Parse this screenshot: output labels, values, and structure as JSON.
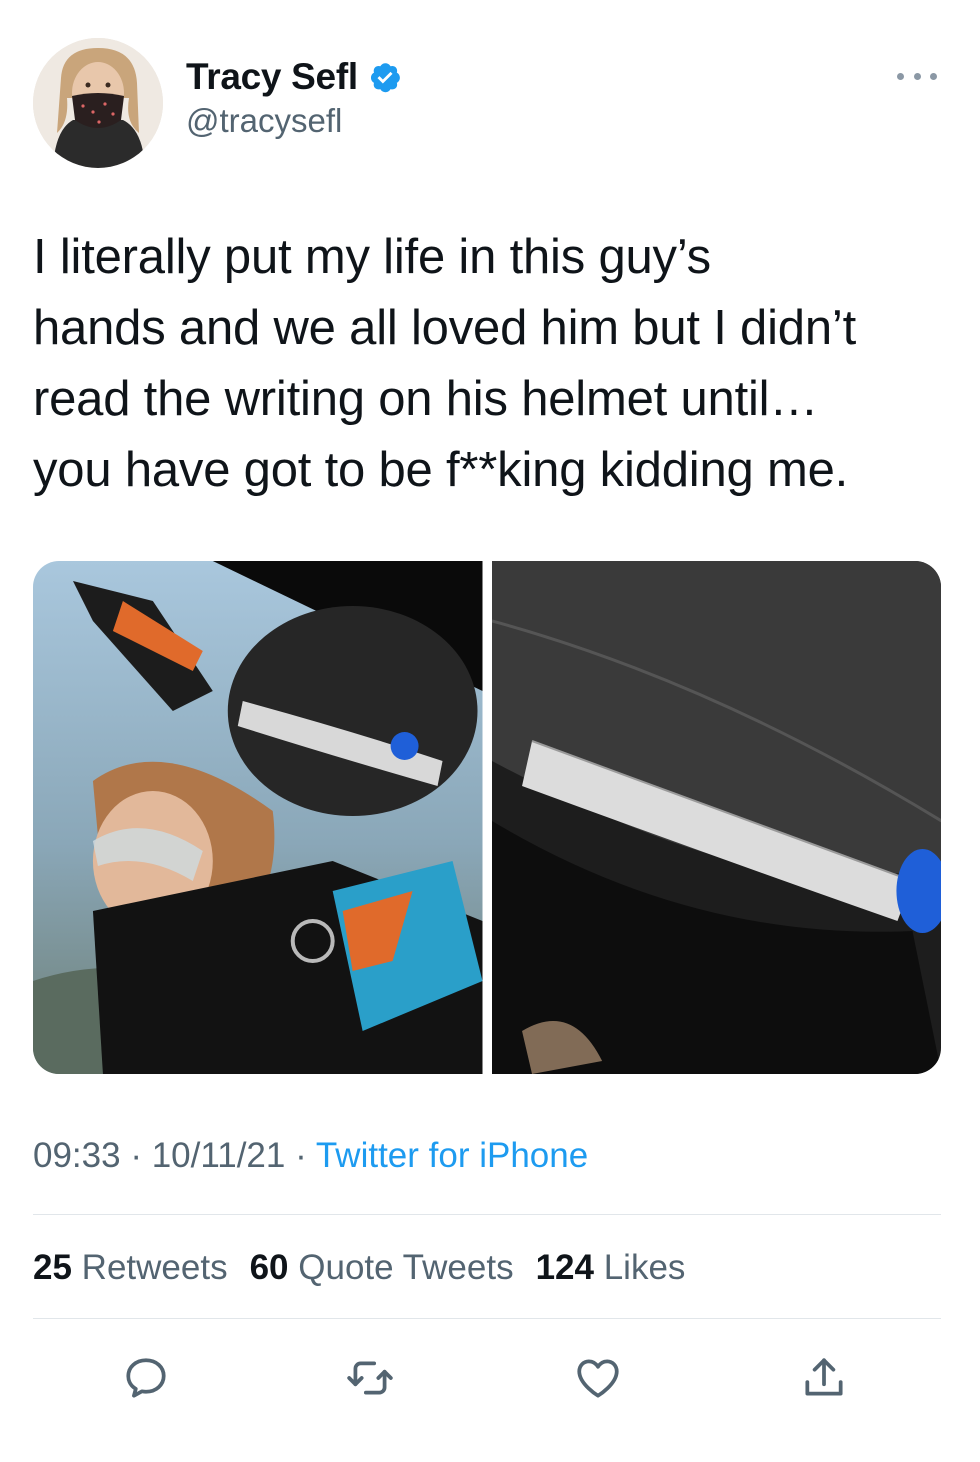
{
  "author": {
    "display_name": "Tracy Sefl",
    "handle": "@tracysefl",
    "verified": true,
    "avatar_icon": "profile-photo"
  },
  "tweet": {
    "text_lines": [
      "I literally put my life in this guy’s",
      "hands and we all loved him but I didn’t",
      "read the writing on his helmet until…",
      "you have got to be f**king kidding me."
    ],
    "media": [
      {
        "icon": "skydiving-photo"
      },
      {
        "icon": "helmet-closeup-photo"
      }
    ]
  },
  "meta": {
    "time": "09:33",
    "separator": " · ",
    "date": "10/11/21",
    "source": "Twitter for iPhone"
  },
  "stats": {
    "retweets_count": "25",
    "retweets_label": "Retweets",
    "quotes_count": "60",
    "quotes_label": "Quote Tweets",
    "likes_count": "124",
    "likes_label": "Likes"
  },
  "actions": [
    "reply-icon",
    "retweet-icon",
    "like-icon",
    "share-icon"
  ],
  "colors": {
    "accent": "#1d9bf0",
    "text": "#0f1419",
    "secondary": "#536471"
  }
}
